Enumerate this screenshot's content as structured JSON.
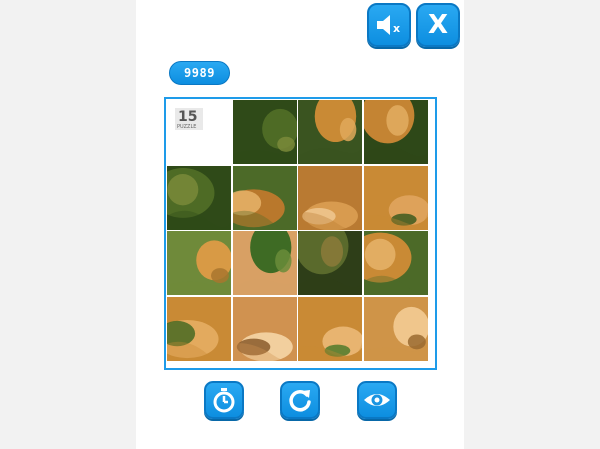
{
  "header": {
    "mute_icon": "speaker-muted-icon",
    "close_label": "X"
  },
  "score": {
    "value": "9989"
  },
  "board": {
    "size": "4x4",
    "empty_tile_logo": "15",
    "empty_tile_logo_sub": "PUZZLE",
    "tiles": [
      {
        "tone": "empty"
      },
      {
        "tone": "foliage-dark"
      },
      {
        "tone": "lion-ear"
      },
      {
        "tone": "lion-ear-right"
      },
      {
        "tone": "foliage-dark"
      },
      {
        "tone": "lion-mane"
      },
      {
        "tone": "lion-face"
      },
      {
        "tone": "lion-mane-right"
      },
      {
        "tone": "lion-body"
      },
      {
        "tone": "grass-lion"
      },
      {
        "tone": "grass-dark"
      },
      {
        "tone": "cub-head"
      },
      {
        "tone": "cub-body"
      },
      {
        "tone": "lion-nose"
      },
      {
        "tone": "lion-grass"
      },
      {
        "tone": "cub-face"
      }
    ]
  },
  "controls": {
    "timer_icon": "stopwatch-icon",
    "restart_icon": "restart-icon",
    "preview_icon": "eye-icon"
  },
  "colors": {
    "accent": "#1e9be9",
    "lion": "#c98a35",
    "foliage": "#3d5a1e"
  }
}
